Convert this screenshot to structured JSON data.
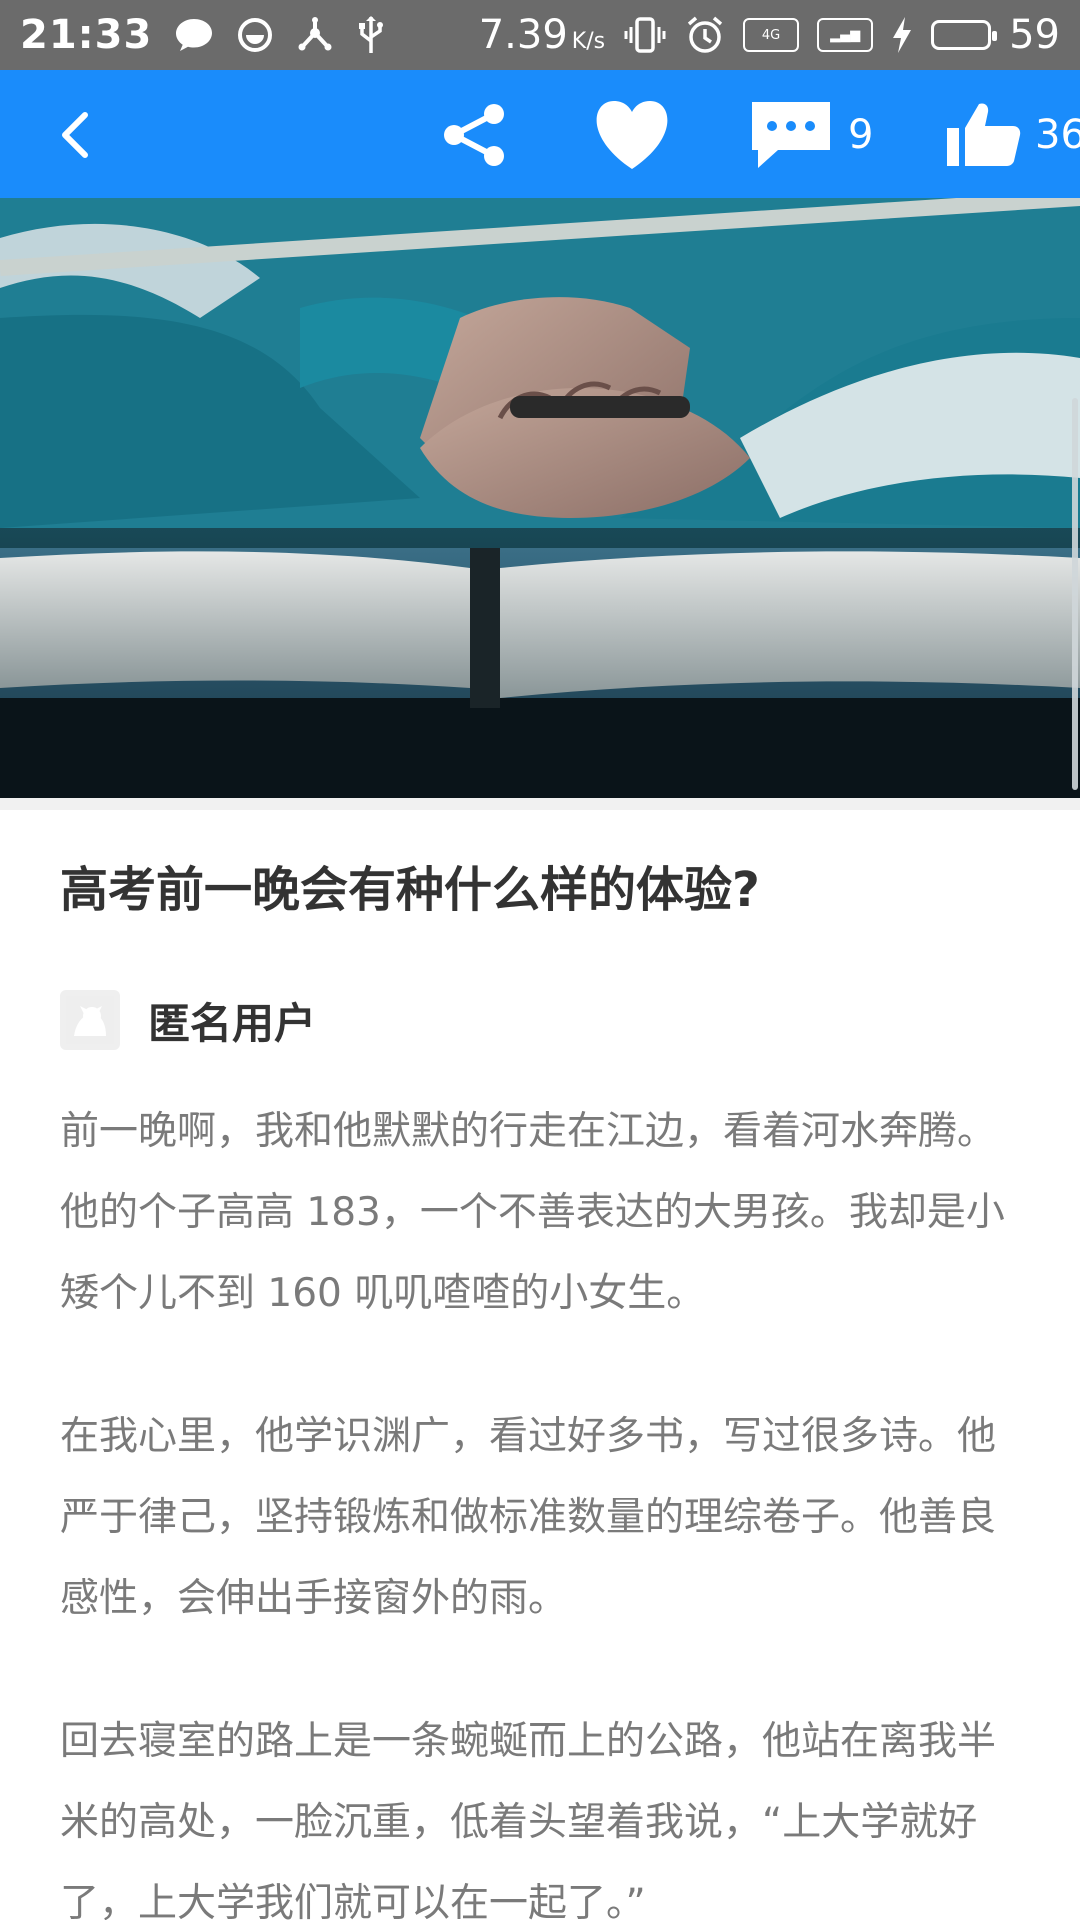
{
  "status_bar": {
    "time": "21:33",
    "speed_value": "7.39",
    "speed_unit": "K/s",
    "battery_percent": "59",
    "battery_level": 0.59,
    "battery_color": "#76d35a",
    "icons": [
      "chat-bubble-icon",
      "smiley-icon",
      "usb-network-icon",
      "usb-icon",
      "vibrate-icon",
      "alarm-icon",
      "signal-4g-icon",
      "signal-icon",
      "charging-icon",
      "battery-icon"
    ]
  },
  "app_bar": {
    "background_color": "#1a8cfb",
    "comment_count": "9",
    "like_count": "36"
  },
  "article": {
    "title": "高考前一晚会有种什么样的体验?",
    "author": "匿名用户",
    "paragraphs": [
      "前一晚啊，我和他默默的行走在江边，看着河水奔腾。他的个子高高 183，一个不善表达的大男孩。我却是小矮个儿不到 160 叽叽喳喳的小女生。",
      "在我心里，他学识渊广，看过好多书，写过很多诗。他严于律己，坚持锻炼和做标准数量的理综卷子。他善良感性，会伸出手接窗外的雨。",
      "回去寝室的路上是一条蜿蜒而上的公路，他站在离我半米的高处，一脸沉重，低着头望着我说，“上大学就好了，上大学我们就可以在一起了。”"
    ]
  }
}
